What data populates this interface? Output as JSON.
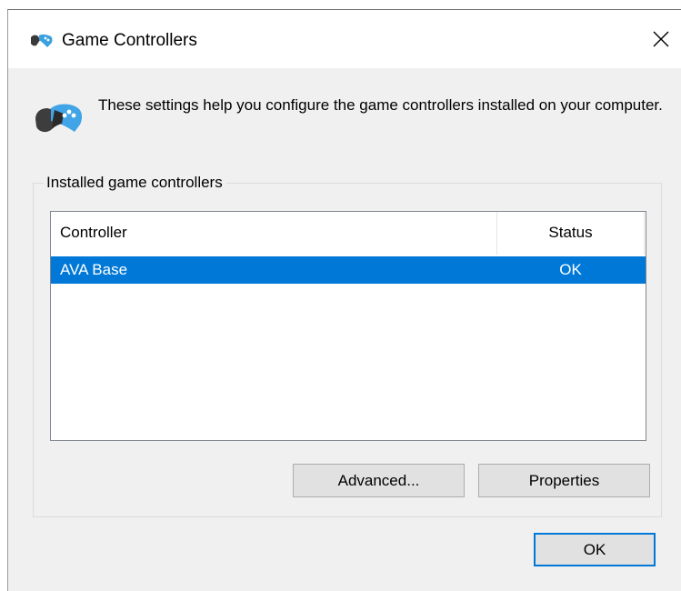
{
  "window": {
    "title": "Game Controllers",
    "close_glyph": "✕"
  },
  "header": {
    "icon": "game-controller-icon",
    "description": "These settings help you configure the game controllers installed on your computer."
  },
  "installed_group": {
    "label": "Installed game controllers",
    "columns": {
      "controller": "Controller",
      "status": "Status"
    },
    "rows": [
      {
        "controller": "AVA Base",
        "status": "OK",
        "selected": true
      }
    ],
    "advanced_label": "Advanced...",
    "properties_label": "Properties"
  },
  "footer": {
    "ok_label": "OK"
  },
  "colors": {
    "accent": "#0078d7",
    "dialog_bg": "#f0f0f0",
    "button_bg": "#e1e1e1"
  }
}
